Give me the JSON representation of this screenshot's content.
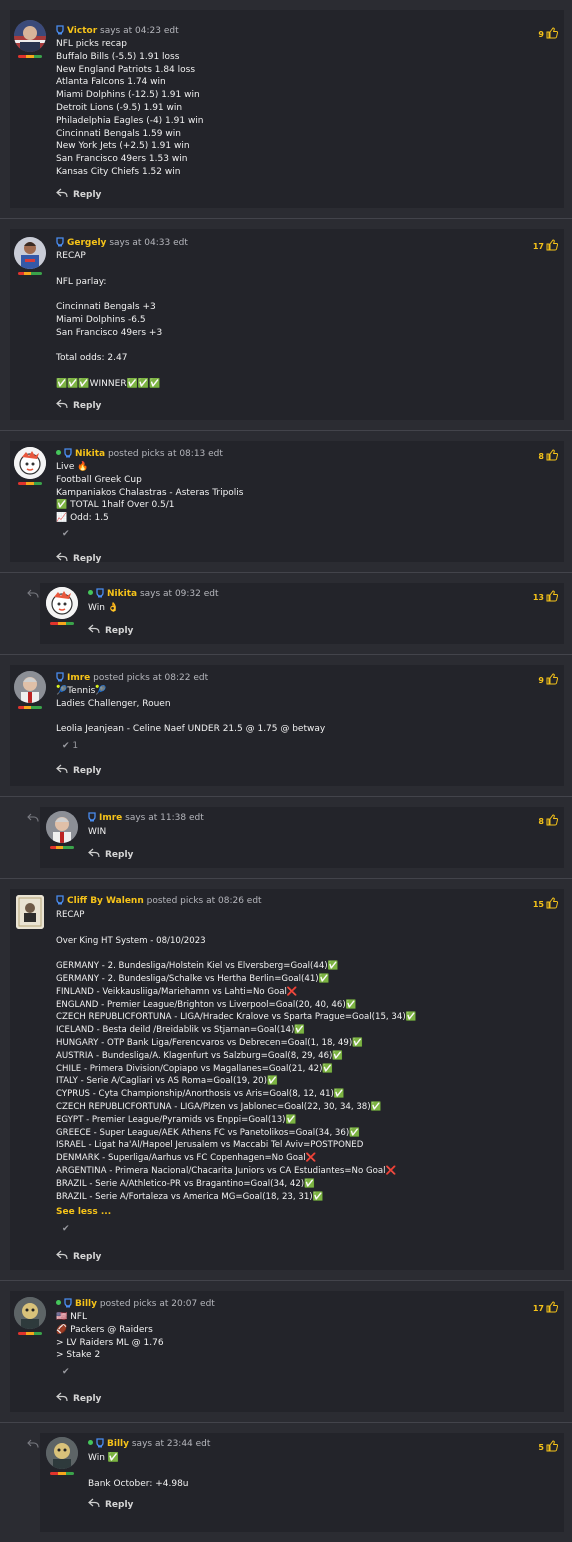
{
  "posts": [
    {
      "username": "Victor",
      "meta": "says at 04:23 edt",
      "likes": "9",
      "online": false,
      "lines": [
        "NFL picks recap",
        "Buffalo Bills (-5.5) 1.91 loss",
        "New England Patriots 1.84 loss",
        "Atlanta Falcons 1.74 win",
        "Miami Dolphins (-12.5) 1.91 win",
        "Detroit Lions (-9.5) 1.91 win",
        "Philadelphia Eagles (-4) 1.91 win",
        "Cincinnati Bengals 1.59 win",
        "New York Jets (+2.5) 1.91 win",
        "San Francisco 49ers 1.53 win",
        "Kansas City Chiefs 1.52 win"
      ],
      "reply_label": "Reply"
    },
    {
      "username": "Gergely",
      "meta": "says at 04:33 edt",
      "likes": "17",
      "online": false,
      "lines": [
        "RECAP",
        "",
        "NFL parlay:",
        "",
        "Cincinnati Bengals +3",
        "Miami Dolphins -6.5",
        "San Francisco 49ers +3",
        "",
        "Total odds: 2.47",
        "",
        "✅✅✅WINNER✅✅✅"
      ],
      "reply_label": "Reply"
    },
    {
      "username": "Nikita",
      "meta": "posted picks at 08:13 edt",
      "likes": "8",
      "online": true,
      "lines": [
        "Live 🔥",
        "Football Greek Cup",
        "Kampaniakos Chalastras - Asteras Tripolis",
        "✅ TOTAL 1half Over 0.5/1",
        "📈 Odd: 1.5"
      ],
      "check": "✔",
      "reply_label": "Reply"
    },
    {
      "username": "Nikita",
      "meta": "says at 09:32 edt",
      "likes": "13",
      "online": true,
      "lines": [
        "Win 👌"
      ],
      "reply_label": "Reply"
    },
    {
      "username": "Imre",
      "meta": "posted picks at 08:22 edt",
      "likes": "9",
      "online": false,
      "lines": [
        "🎾Tennis🎾",
        "Ladies Challenger, Rouen",
        "",
        "Leolia Jeanjean - Celine Naef UNDER 21.5 @ 1.75 @ betway"
      ],
      "check": "✔ 1",
      "reply_label": "Reply"
    },
    {
      "username": "Imre",
      "meta": "says at 11:38 edt",
      "likes": "8",
      "online": false,
      "lines": [
        "WIN"
      ],
      "reply_label": "Reply"
    },
    {
      "username": "Cliff By Walenn",
      "meta": "posted picks at 08:26 edt",
      "likes": "15",
      "online": false,
      "lines": [
        "RECAP",
        "",
        "Over King HT System - 08/10/2023",
        "",
        "GERMANY - 2. Bundesliga/Holstein Kiel vs Elversberg=Goal(44)✅",
        "GERMANY - 2. Bundesliga/Schalke vs Hertha Berlin=Goal(41)✅",
        "FINLAND - Veikkausliiga/Mariehamn vs Lahti=No Goal❌",
        "ENGLAND - Premier League/Brighton vs Liverpool=Goal(20, 40, 46)✅",
        "CZECH REPUBLICFORTUNA - LIGA/Hradec Kralove vs Sparta Prague=Goal(15, 34)✅",
        "ICELAND - Besta deild /Breidablik vs Stjarnan=Goal(14)✅",
        "HUNGARY - OTP Bank Liga/Ferencvaros vs Debrecen=Goal(1, 18, 49)✅",
        "AUSTRIA - Bundesliga/A. Klagenfurt vs Salzburg=Goal(8, 29, 46)✅",
        "CHILE - Primera Division/Copiapo vs Magallanes=Goal(21, 42)✅",
        "ITALY - Serie A/Cagliari vs AS Roma=Goal(19, 20)✅",
        "CYPRUS - Cyta Championship/Anorthosis vs Aris=Goal(8, 12, 41)✅",
        "CZECH REPUBLICFORTUNA - LIGA/Plzen vs Jablonec=Goal(22, 30, 34, 38)✅",
        "EGYPT - Premier League/Pyramids vs Enppi=Goal(13)✅",
        "GREECE - Super League/AEK Athens FC vs Panetolikos=Goal(34, 36)✅",
        "ISRAEL - Ligat ha'Al/Hapoel Jerusalem vs Maccabi Tel Aviv=POSTPONED",
        "DENMARK - Superliga/Aarhus vs FC Copenhagen=No Goal❌",
        "ARGENTINA - Primera Nacional/Chacarita Juniors vs CA Estudiantes=No Goal❌",
        "BRAZIL - Serie A/Athletico-PR vs Bragantino=Goal(34, 42)✅",
        "BRAZIL - Serie A/Fortaleza vs America MG=Goal(18, 23, 31)✅"
      ],
      "see_less": "See less ...",
      "check": "✔",
      "reply_label": "Reply"
    },
    {
      "username": "Billy",
      "meta": "posted picks at 20:07 edt",
      "likes": "17",
      "online": true,
      "lines": [
        "🇺🇸 NFL",
        "🏈 Packers @ Raiders",
        "> LV Raiders ML @ 1.76",
        "> Stake 2"
      ],
      "check": "✔",
      "reply_label": "Reply"
    },
    {
      "username": "Billy",
      "meta": "says at 23:44 edt",
      "likes": "5",
      "online": true,
      "lines": [
        "Win ✅",
        "",
        "Bank October: +4.98u"
      ],
      "reply_label": "Reply"
    }
  ],
  "colors": {
    "accent": "#f6c319",
    "background": "#2b2c32",
    "card": "#23242a"
  }
}
